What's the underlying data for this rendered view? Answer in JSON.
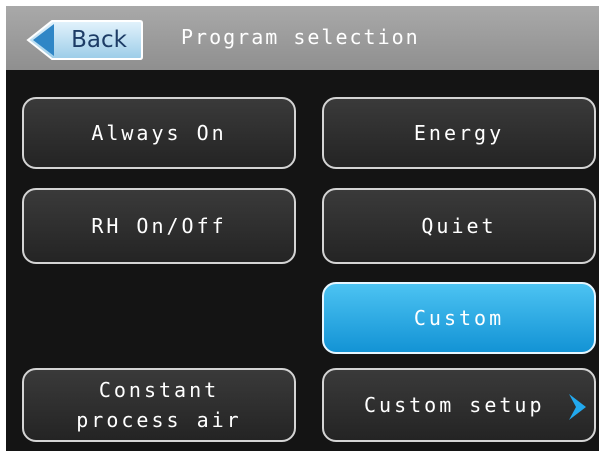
{
  "header": {
    "back_label": "Back",
    "title": "Program selection"
  },
  "programs": {
    "always_on": "Always On",
    "energy": "Energy",
    "rh_on_off": "RH On/Off",
    "quiet": "Quiet",
    "custom": "Custom",
    "constant_line1": "Constant",
    "constant_line2": "process air",
    "custom_setup": "Custom setup"
  },
  "selected_program": "Custom",
  "icons": {
    "back": "back-arrow-icon",
    "custom_setup": "chevron-right-icon"
  },
  "colors": {
    "header_bg": "#9c9c9c",
    "screen_bg": "#141414",
    "selected_accent": "#1ea7e6",
    "back_button": "#bfe0f3"
  }
}
